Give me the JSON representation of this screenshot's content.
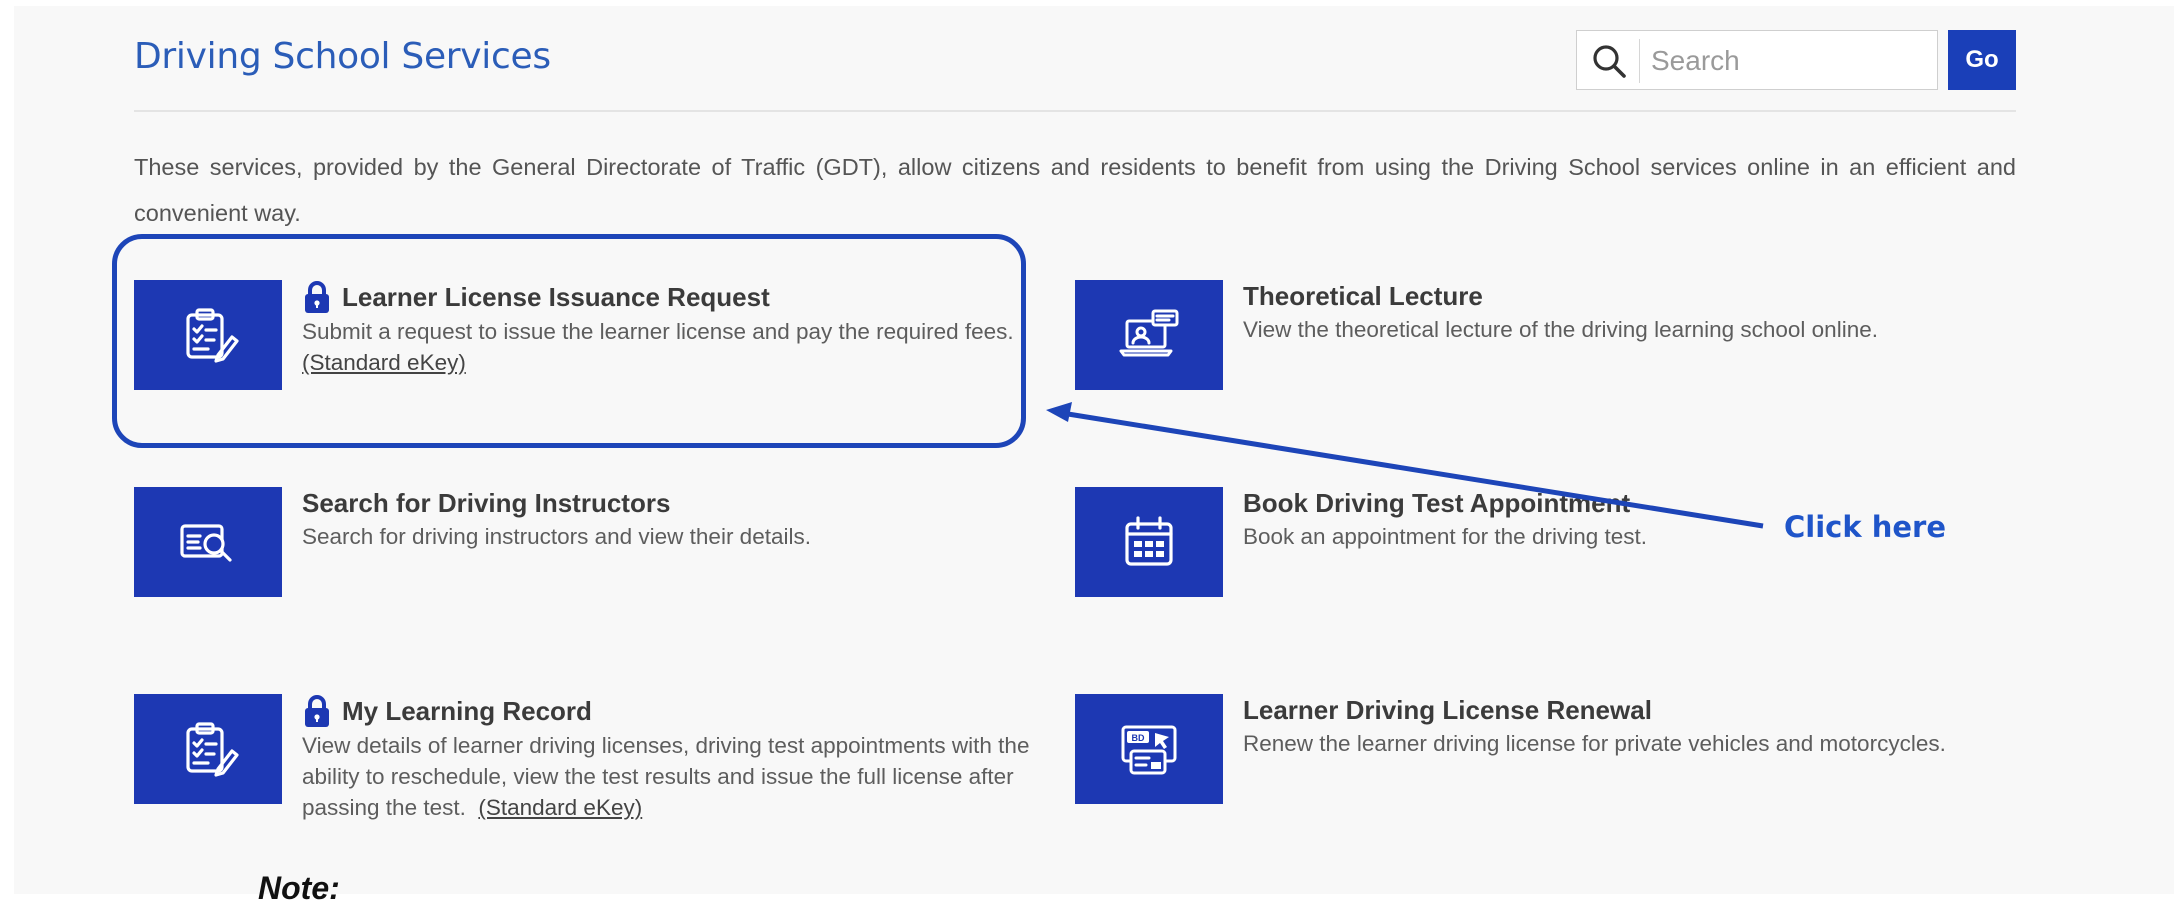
{
  "header": {
    "title": "Driving School Services",
    "search_placeholder": "Search",
    "go_label": "Go"
  },
  "intro": "These services, provided by the General Directorate of Traffic (GDT), allow citizens and residents to benefit from using the Driving School services online in an efficient and convenient way.",
  "services": [
    {
      "title": "Learner License Issuance Request",
      "locked": true,
      "description": "Submit a request to issue the learner license and pay the required fees.",
      "ekey_label": "(Standard eKey)",
      "icon": "clipboard-checklist-icon"
    },
    {
      "title": "Theoretical Lecture",
      "locked": false,
      "description": "View the theoretical lecture of the driving learning school online.",
      "icon": "laptop-lecture-icon"
    },
    {
      "title": "Search for Driving Instructors",
      "locked": false,
      "description": "Search for driving instructors and view their details.",
      "icon": "instructor-search-icon"
    },
    {
      "title": "Book Driving Test Appointment",
      "locked": false,
      "description": "Book an appointment for the driving test.",
      "icon": "calendar-icon"
    },
    {
      "title": "My Learning Record",
      "locked": true,
      "description": "View details of learner driving licenses, driving test appointments with the ability to reschedule, view the test results and issue the full license after passing the test.",
      "ekey_label": "(Standard eKey)",
      "icon": "clipboard-checklist-icon"
    },
    {
      "title": "Learner Driving License Renewal",
      "locked": false,
      "description": "Renew the learner driving license for private vehicles and motorcycles.",
      "icon_badge_text": "BD",
      "icon": "license-card-icon"
    }
  ],
  "annotation": {
    "callout": "Click here",
    "note": "Note:"
  },
  "colors": {
    "brand_blue": "#1d38b3",
    "title_blue": "#2b5db8",
    "annotation_blue": "#1f55c9",
    "panel_bg": "#f8f8f8"
  }
}
